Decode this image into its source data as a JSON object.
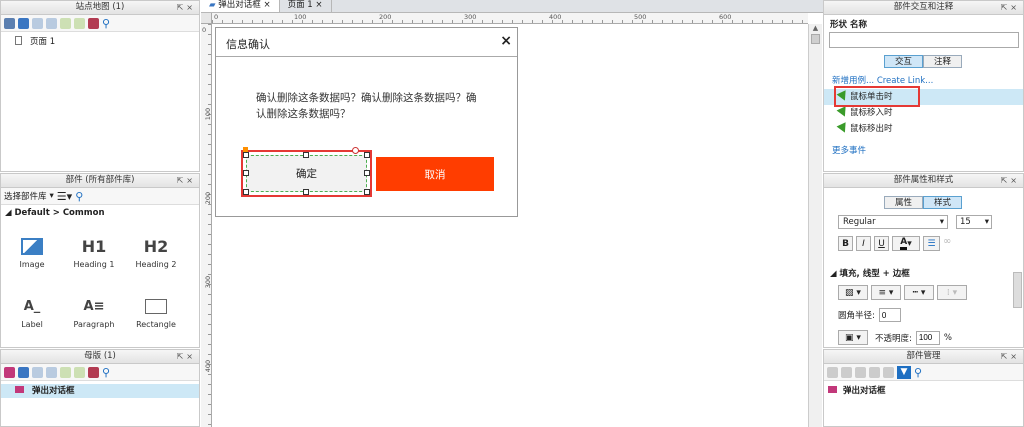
{
  "sitemap": {
    "title": "站点地图 (1)",
    "pages": [
      "页面 1"
    ]
  },
  "widgets": {
    "title": "部件 (所有部件库)",
    "lib_select": "选择部件库",
    "category": "Default > Common",
    "items": [
      {
        "label": "Image",
        "glyph": "image-icon"
      },
      {
        "label": "Heading 1",
        "glyph": "H1"
      },
      {
        "label": "Heading 2",
        "glyph": "H2"
      },
      {
        "label": "Label",
        "glyph": "A_"
      },
      {
        "label": "Paragraph",
        "glyph": "A≡"
      },
      {
        "label": "Rectangle",
        "glyph": "rect"
      }
    ]
  },
  "masters": {
    "title": "母版 (1)",
    "items": [
      "弹出对话框"
    ]
  },
  "tabs": [
    "弹出对话框",
    "页面 1"
  ],
  "ruler": {
    "h": [
      "0",
      "100",
      "200",
      "300",
      "400",
      "500",
      "600"
    ],
    "v": [
      "0",
      "100",
      "200",
      "300",
      "400"
    ]
  },
  "dialog": {
    "title": "信息确认",
    "close": "×",
    "message": "确认删除这条数据吗？确认删除这条数据吗？确认删除这条数据吗？",
    "confirm": "确定",
    "cancel": "取消",
    "cancel_color": "#ff3d00"
  },
  "interaction": {
    "title": "部件交互和注释",
    "shape_label": "形状",
    "name_label": "名称",
    "name_value": "",
    "tab_interact": "交互",
    "tab_notes": "注释",
    "new_case": "新增用例...",
    "create_link": "Create Link...",
    "events": [
      "鼠标单击时",
      "鼠标移入时",
      "鼠标移出时"
    ],
    "more": "更多事件"
  },
  "style": {
    "title": "部件属性和样式",
    "tab_props": "属性",
    "tab_style": "样式",
    "font_weight": "Regular",
    "font_size": "15",
    "bold": "B",
    "italic": "I",
    "underline": "U",
    "section": "填充, 线型 + 边框",
    "radius_label": "圆角半径:",
    "radius_value": "0",
    "opacity_label": "不透明度:",
    "opacity_value": "100",
    "opacity_unit": "%"
  },
  "manager": {
    "title": "部件管理",
    "items": [
      "弹出对话框"
    ]
  }
}
